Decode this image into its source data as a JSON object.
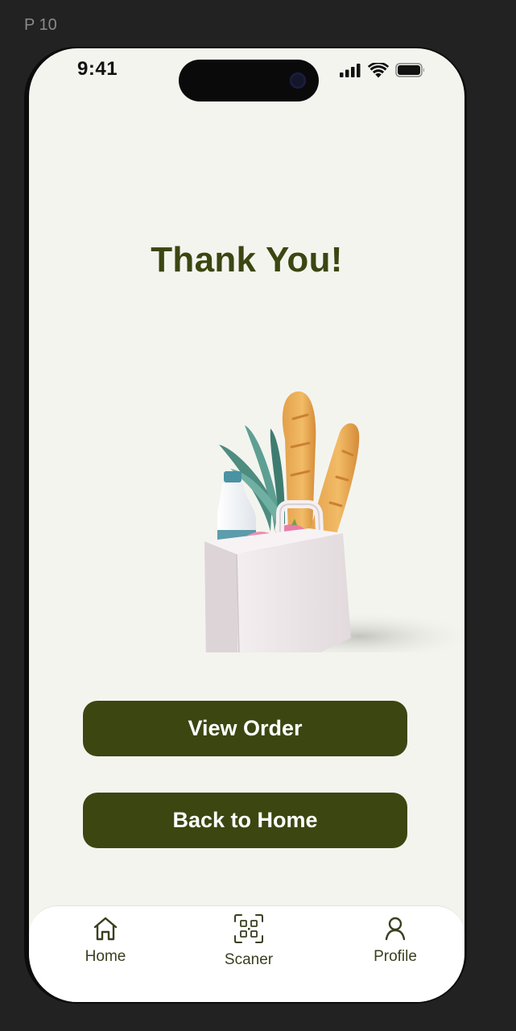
{
  "frame": {
    "label": "P 10"
  },
  "status_bar": {
    "time": "9:41"
  },
  "main": {
    "title": "Thank You!",
    "illustration": "grocery-bag-illustration",
    "buttons": {
      "view_order": "View Order",
      "back_home": "Back to Home"
    }
  },
  "tabbar": {
    "items": [
      {
        "label": "Home",
        "icon": "home-icon"
      },
      {
        "label": "Scaner",
        "icon": "qr-scan-icon"
      },
      {
        "label": "Profile",
        "icon": "profile-icon"
      }
    ]
  },
  "colors": {
    "accent": "#3b4611",
    "background": "#f4f4ef",
    "frame": "#222222"
  }
}
